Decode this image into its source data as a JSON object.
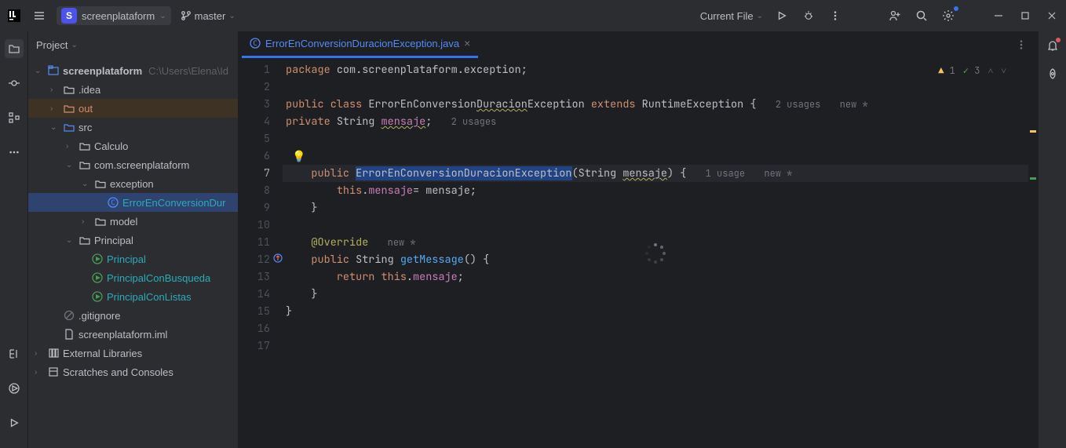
{
  "titlebar": {
    "project_initial": "S",
    "project_name": "screenplataform",
    "branch": "master",
    "current_file": "Current File"
  },
  "panel": {
    "title": "Project"
  },
  "tree": {
    "project_root": "screenplataform",
    "project_root_path": "C:\\Users\\Elena\\Id",
    "idea": ".idea",
    "out": "out",
    "src": "src",
    "calculo": "Calculo",
    "pkg": "com.screenplataform",
    "exception": "exception",
    "exception_file": "ErrorEnConversionDur",
    "model": "model",
    "principal_pkg": "Principal",
    "principal": "Principal",
    "principal_busqueda": "PrincipalConBusqueda",
    "principal_listas": "PrincipalConListas",
    "gitignore": ".gitignore",
    "iml": "screenplataform.iml",
    "ext_libs": "External Libraries",
    "scratches": "Scratches and Consoles"
  },
  "tab": {
    "name": "ErrorEnConversionDuracionException.java"
  },
  "inspections": {
    "warnings": "1",
    "weak": "3"
  },
  "gutter": [
    "1",
    "2",
    "3",
    "4",
    "5",
    "6",
    "7",
    "8",
    "9",
    "10",
    "11",
    "12",
    "13",
    "14",
    "15",
    "16",
    "17"
  ],
  "code": {
    "pkg_kw": "package ",
    "pkg_name": "com.screenplataform.exception",
    "semi": ";",
    "public": "public ",
    "class": "class ",
    "classname": "ErrorEnConversion",
    "classname_underline": "Duracion",
    "classname_tail": "Exception ",
    "extends": "extends ",
    "runtime": "RuntimeException ",
    "obrace": "{",
    "hint_2usages": "2 usages",
    "hint_newstar": "new *",
    "private": "private ",
    "string_t": "String ",
    "mensaje_field": "mensaje",
    "ctor_public": "public ",
    "ctor_name": "ErrorEnConversionDuracionException",
    "ctor_params_open": "(String ",
    "ctor_param_name": "mensaje",
    "ctor_params_close": ") {",
    "hint_1usage": "1 usage",
    "this": "this",
    "dot": ".",
    "eq": "= mensaje;",
    "cbrace": "}",
    "override": "@Override",
    "getmessage": "getMessage",
    "getmessage_sig_open": "public ",
    "getmessage_sig_type": "String ",
    "getmessage_sig_close": "() {",
    "return": "return ",
    "return_tail": ";"
  }
}
